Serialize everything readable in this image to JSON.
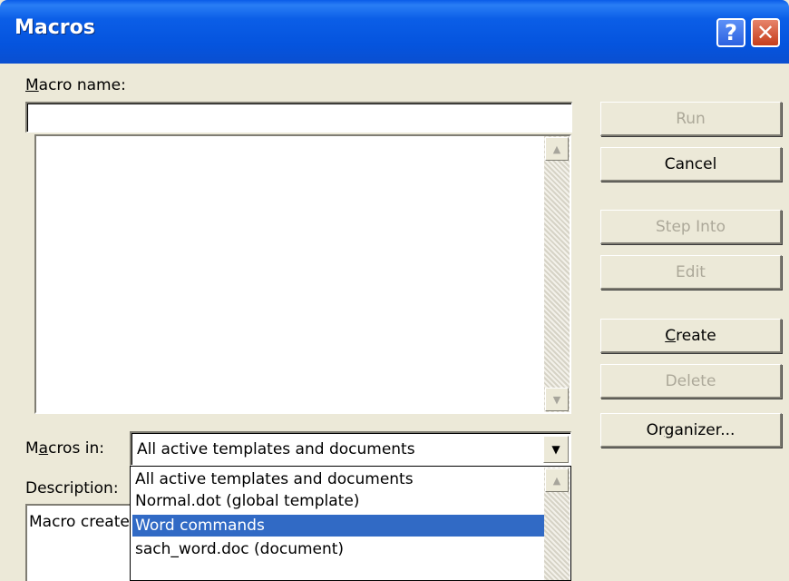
{
  "window": {
    "title": "Macros",
    "help_glyph": "?",
    "close_glyph": "✕"
  },
  "macro_name": {
    "label_underlined": "M",
    "label_rest": "acro name:",
    "value": ""
  },
  "buttons": {
    "run": "Run",
    "cancel": "Cancel",
    "step_into": "Step Into",
    "edit": "Edit",
    "create_underlined": "C",
    "create_rest": "reate",
    "delete": "Delete",
    "organizer_pre": "Or",
    "organizer_underlined": "g",
    "organizer_post": "anizer..."
  },
  "macros_in": {
    "label_pre": "M",
    "label_underlined": "a",
    "label_post": "cros in:",
    "selected": "All active templates and documents",
    "options": [
      "All active templates and documents",
      "Normal.dot (global template)",
      "Word commands",
      "sach_word.doc (document)"
    ],
    "highlighted_index": 2
  },
  "description": {
    "label": "Description:",
    "value": "Macro created"
  },
  "icons": {
    "scroll_up": "▲",
    "scroll_down": "▼",
    "dropdown_arrow": "▼"
  }
}
